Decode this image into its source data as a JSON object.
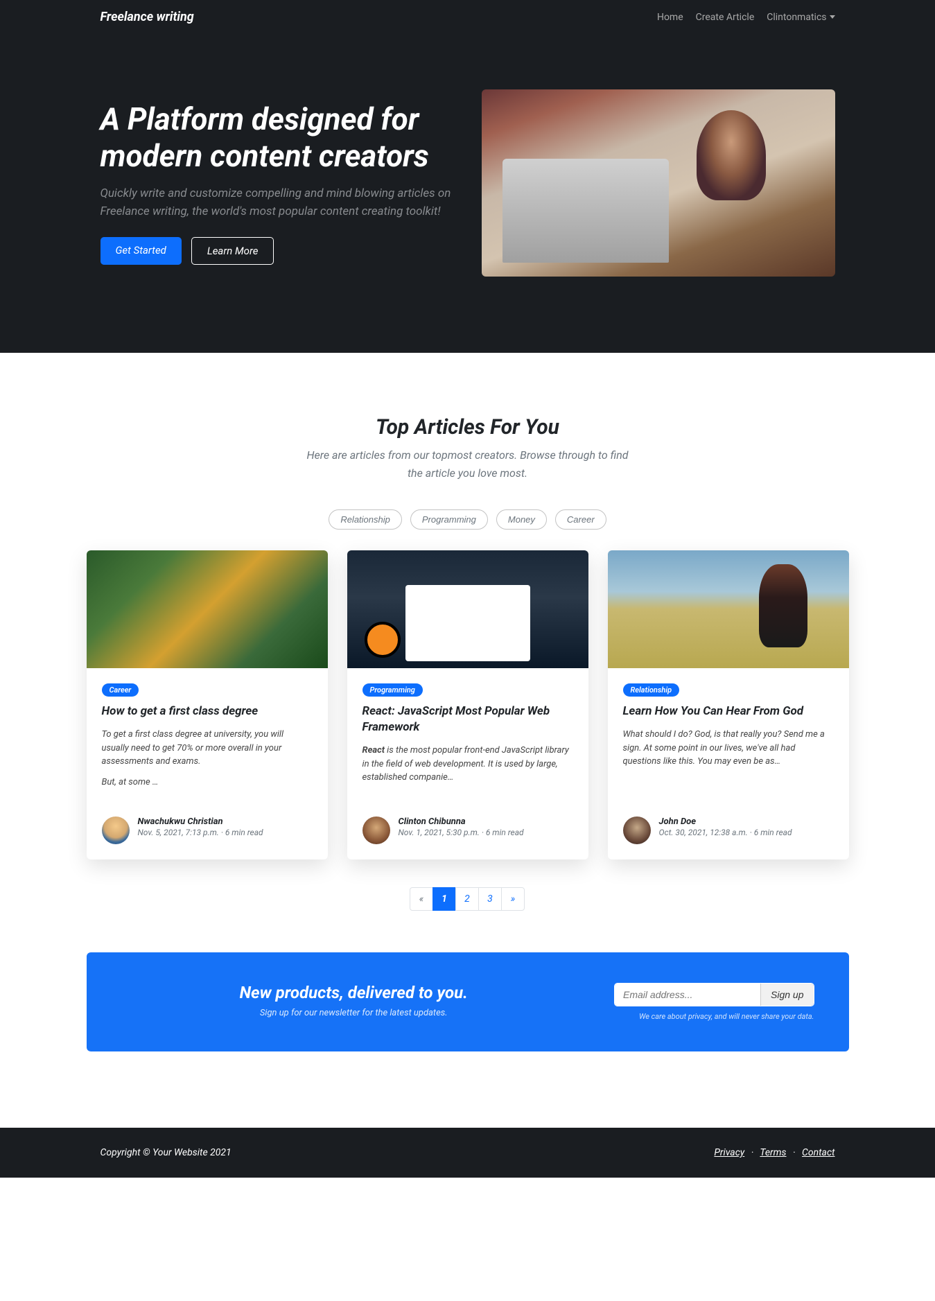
{
  "brand": "Freelance writing",
  "nav": {
    "home": "Home",
    "create": "Create Article",
    "user": "Clintonmatics"
  },
  "hero": {
    "title": "A Platform designed for modern content creators",
    "subtitle": "Quickly write and customize compelling and mind blowing articles on Freelance writing, the world's most popular content creating toolkit!",
    "cta_primary": "Get Started",
    "cta_secondary": "Learn More"
  },
  "articles": {
    "title": "Top Articles For You",
    "lead": "Here are articles from our topmost creators. Browse through to find the article you love most.",
    "categories": [
      "Relationship",
      "Programming",
      "Money",
      "Career"
    ],
    "cards": [
      {
        "badge": "Career",
        "title": "How to get a first class degree",
        "excerpt1": "To get a first class degree at university, you will usually need to get 70% or more overall in your assessments and exams.",
        "excerpt2": "But, at some …",
        "author": "Nwachukwu Christian",
        "meta": "Nov. 5, 2021, 7:13 p.m. · 6 min read"
      },
      {
        "badge": "Programming",
        "title": "React: JavaScript Most Popular Web Framework",
        "excerpt_strong": "React",
        "excerpt_rest": " is the most popular front-end JavaScript library in the field of web development. It is used by large, established companie…",
        "author": "Clinton Chibunna",
        "meta": "Nov. 1, 2021, 5:30 p.m. · 6 min read"
      },
      {
        "badge": "Relationship",
        "title": "Learn How You Can Hear From God",
        "excerpt1": "What should I do? God, is that really you? Send me a sign. At some point in our lives, we've all had questions like this. You may even be as…",
        "author": "John Doe",
        "meta": "Oct. 30, 2021, 12:38 a.m. · 6 min read"
      }
    ]
  },
  "pager": {
    "prev": "«",
    "p1": "1",
    "p2": "2",
    "p3": "3",
    "next": "»"
  },
  "newsletter": {
    "title": "New products, delivered to you.",
    "sub": "Sign up for our newsletter for the latest updates.",
    "placeholder": "Email address...",
    "button": "Sign up",
    "privacy": "We care about privacy, and will never share your data."
  },
  "footer": {
    "copy": "Copyright © Your Website 2021",
    "privacy": "Privacy",
    "terms": "Terms",
    "contact": "Contact",
    "sep": "·"
  }
}
